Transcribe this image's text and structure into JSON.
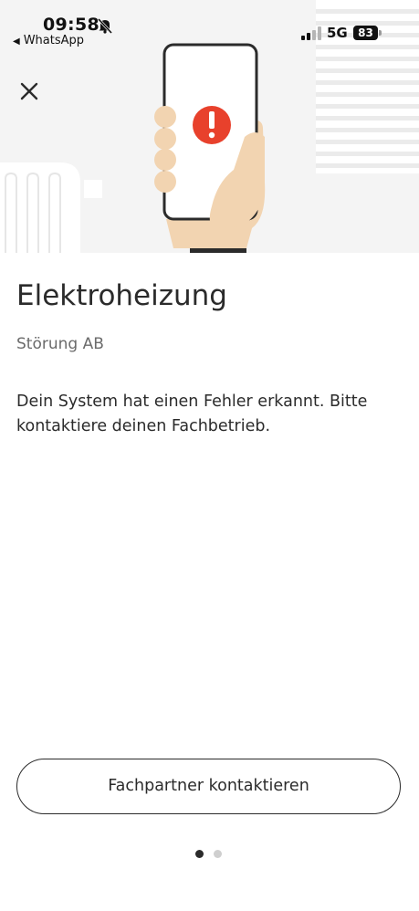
{
  "status_bar": {
    "time": "09:58",
    "back_app": "WhatsApp",
    "network": "5G",
    "battery": "83"
  },
  "icons": {
    "close": "close-icon",
    "bell_off": "bell-off-icon",
    "alert": "exclamation-alert-icon"
  },
  "main": {
    "title": "Elektroheizung",
    "subtitle": "Störung AB",
    "message": "Dein System hat einen Fehler erkannt. Bitte kontaktiere deinen Fachbetrieb.",
    "contact_button": "Fachpartner kontaktieren"
  },
  "pager": {
    "page_count": 2,
    "current_page": 1
  },
  "colors": {
    "alert_red": "#e8412c",
    "hand": "#f2d4b1",
    "text": "#2b2b2b",
    "hero_bg": "#f4f4f4"
  }
}
